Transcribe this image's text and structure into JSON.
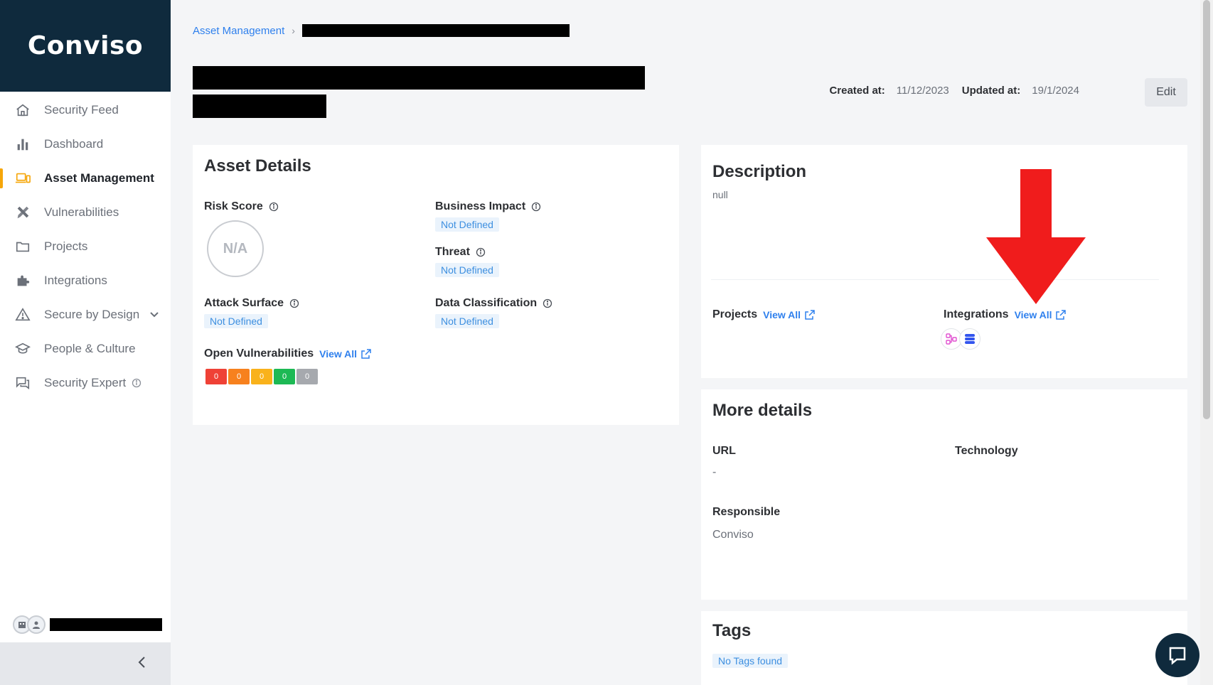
{
  "brand": {
    "name": "Conviso"
  },
  "sidebar": {
    "items": [
      {
        "label": "Security Feed",
        "icon": "home-icon"
      },
      {
        "label": "Dashboard",
        "icon": "bar-chart-icon"
      },
      {
        "label": "Asset Management",
        "icon": "devices-icon",
        "active": true
      },
      {
        "label": "Vulnerabilities",
        "icon": "bug-tools-icon"
      },
      {
        "label": "Projects",
        "icon": "folder-icon"
      },
      {
        "label": "Integrations",
        "icon": "puzzle-icon"
      },
      {
        "label": "Secure by Design",
        "icon": "warning-triangle-icon"
      },
      {
        "label": "People & Culture",
        "icon": "graduation-cap-icon"
      },
      {
        "label": "Security Expert",
        "icon": "chat-icon"
      }
    ]
  },
  "breadcrumb": {
    "root": "Asset Management"
  },
  "meta": {
    "created_label": "Created at:",
    "created_value": "11/12/2023",
    "updated_label": "Updated at:",
    "updated_value": "19/1/2024",
    "edit_label": "Edit"
  },
  "asset_details": {
    "title": "Asset Details",
    "risk_score_label": "Risk Score",
    "risk_score_value": "N/A",
    "business_impact_label": "Business Impact",
    "business_impact_value": "Not Defined",
    "threat_label": "Threat",
    "threat_value": "Not Defined",
    "attack_surface_label": "Attack Surface",
    "attack_surface_value": "Not Defined",
    "data_classification_label": "Data Classification",
    "data_classification_value": "Not Defined",
    "open_vulns_label": "Open Vulnerabilities",
    "view_all": "View All",
    "vuln_counts": [
      {
        "value": "0",
        "color": "#ef4136"
      },
      {
        "value": "0",
        "color": "#f7811e"
      },
      {
        "value": "0",
        "color": "#f9b21b"
      },
      {
        "value": "0",
        "color": "#1db954"
      },
      {
        "value": "0",
        "color": "#a6a9ae"
      }
    ]
  },
  "description": {
    "title": "Description",
    "value": "null",
    "projects_label": "Projects",
    "integrations_label": "Integrations",
    "view_all": "View All"
  },
  "more_details": {
    "title": "More details",
    "url_label": "URL",
    "url_value": "-",
    "technology_label": "Technology",
    "responsible_label": "Responsible",
    "responsible_value": "Conviso"
  },
  "tags": {
    "title": "Tags",
    "empty": "No Tags found"
  },
  "colors": {
    "brand_bg": "#0f2a3d",
    "accent": "#f6a609",
    "link": "#2f80ed",
    "annotation_arrow": "#f01c1c"
  }
}
